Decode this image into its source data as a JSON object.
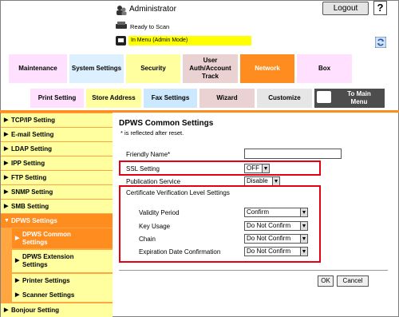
{
  "header": {
    "user": "Administrator",
    "logout": "Logout",
    "help": "?",
    "status": "Ready to Scan",
    "mode": "In Menu (Admin Mode)"
  },
  "tabs_top": [
    "Maintenance",
    "System Settings",
    "Security",
    "User Auth/Account Track",
    "Network",
    "Box"
  ],
  "tabs_sub": [
    "Print Setting",
    "Store Address",
    "Fax Settings",
    "Wizard",
    "Customize",
    "To Main Menu"
  ],
  "sidebar": {
    "items": [
      "TCP/IP Setting",
      "E-mail Setting",
      "LDAP Setting",
      "IPP Setting",
      "FTP Setting",
      "SNMP Setting",
      "SMB Setting",
      "DPWS Settings",
      "DPWS Common Settings",
      "DPWS Extension Settings",
      "Printer Settings",
      "Scanner Settings",
      "Bonjour Setting"
    ]
  },
  "content": {
    "title": "DPWS Common Settings",
    "note": "* is reflected after reset.",
    "friendly_name_label": "Friendly Name*",
    "friendly_name_value": "",
    "ssl_label": "SSL Setting",
    "ssl_value": "OFF",
    "publication_label": "Publication Service",
    "publication_value": "Disable",
    "cert_title": "Certificate Verification Level Settings",
    "validity_label": "Validity Period",
    "validity_value": "Confirm",
    "keyusage_label": "Key Usage",
    "keyusage_value": "Do Not Confirm",
    "chain_label": "Chain",
    "chain_value": "Do Not Confirm",
    "expiration_label": "Expiration Date Confirmation",
    "expiration_value": "Do Not Confirm",
    "ok": "OK",
    "cancel": "Cancel"
  },
  "colors": {
    "accent": "#ff8c1f",
    "highlight": "#e60012",
    "nav_bg": "#ffff9f"
  }
}
